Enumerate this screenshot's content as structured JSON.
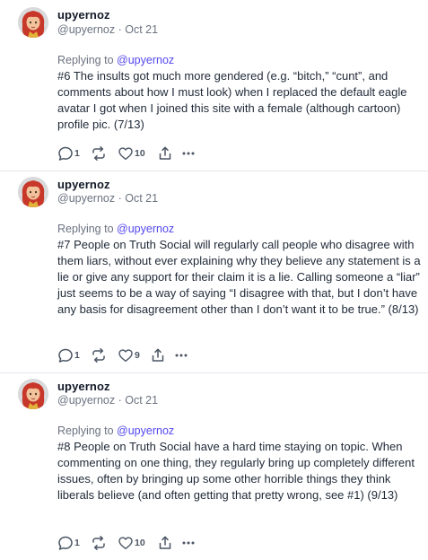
{
  "posts": [
    {
      "author": "upyernoz",
      "handle": "@upyernoz",
      "date": "Oct 21",
      "replying_prefix": "Replying to",
      "replying_to": "@upyernoz",
      "text": "#6 The insults got much more gendered (e.g. “bitch,” “cunt”, and comments about how I must look) when I replaced the default eagle avatar I got when I joined this site with a female (although cartoon) profile pic. (7/13)",
      "replies": "1",
      "likes": "10"
    },
    {
      "author": "upyernoz",
      "handle": "@upyernoz",
      "date": "Oct 21",
      "replying_prefix": "Replying to",
      "replying_to": "@upyernoz",
      "text": "#7 People on Truth Social will regularly call people who disagree with them liars, without ever explaining why they believe any statement is a lie or give any support for their claim it is a lie. Calling someone a “liar” just seems to be a way of saying “I disagree with that, but I don’t have any basis for disagreement other than I don’t want it to be true.” (8/13)",
      "replies": "1",
      "likes": "9"
    },
    {
      "author": "upyernoz",
      "handle": "@upyernoz",
      "date": "Oct 21",
      "replying_prefix": "Replying to",
      "replying_to": "@upyernoz",
      "text": "#8 People on Truth Social have a hard time staying on topic. When commenting on one thing, they regularly bring up completely different issues, often by bringing up some other horrible things they think liberals believe (and often getting that pretty wrong, see #1) (9/13)",
      "replies": "1",
      "likes": "10"
    }
  ],
  "icons": {
    "reply": "reply-icon",
    "retruth": "retruth-icon",
    "like": "heart-icon",
    "share": "share-icon",
    "more": "more-icon"
  },
  "colors": {
    "mention": "#5448ee",
    "muted": "#6b7280",
    "text": "#1f2937",
    "separator": "#e5e7eb"
  }
}
